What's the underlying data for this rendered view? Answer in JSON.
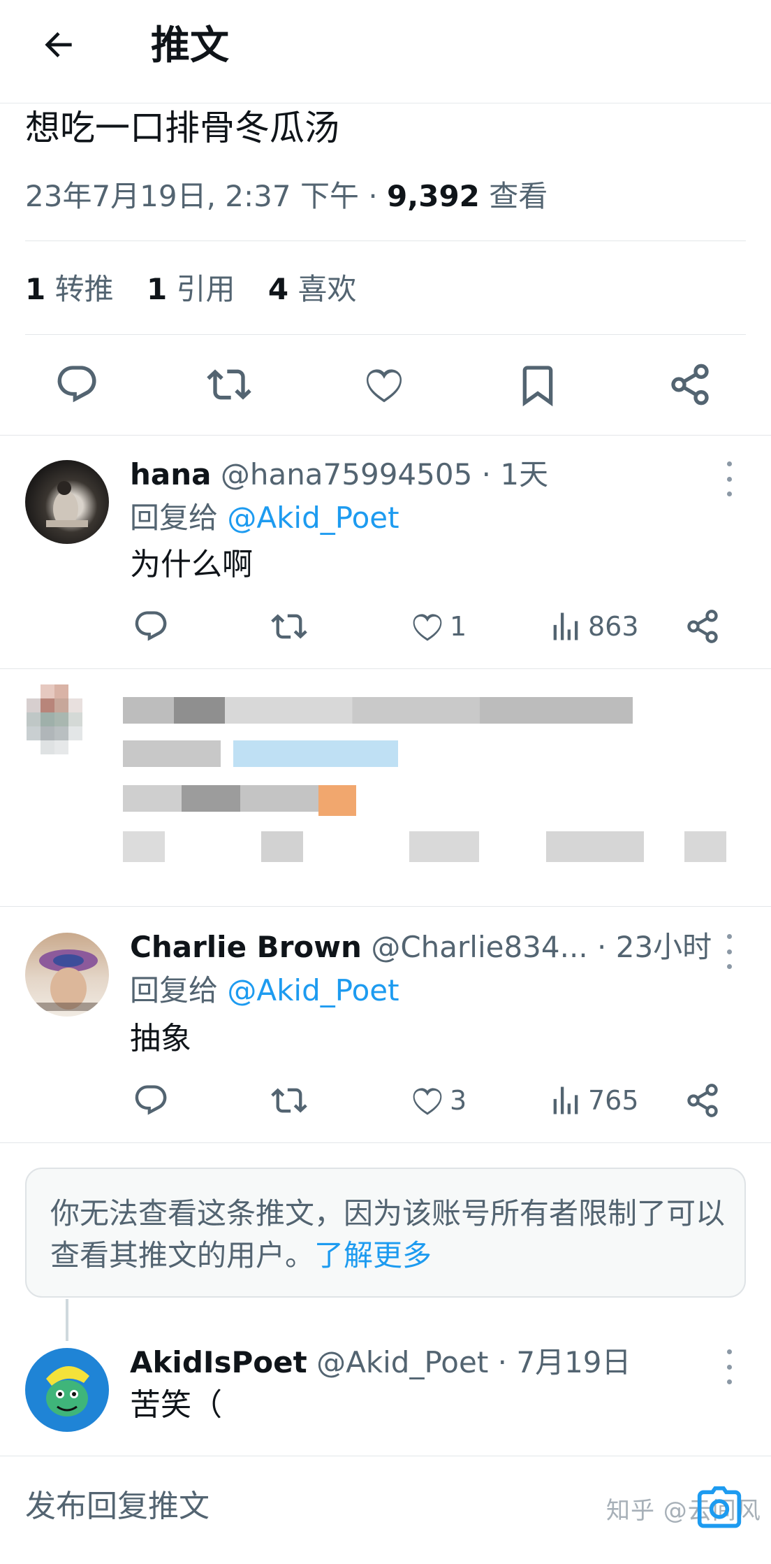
{
  "header": {
    "title": "推文"
  },
  "tweet": {
    "text": "想吃一口排骨冬瓜汤",
    "timestamp": "23年7月19日, 2:37 下午",
    "separator": " · ",
    "views_count": "9,392",
    "views_label": " 查看",
    "stats": {
      "retweets_num": "1",
      "retweets_label": " 转推",
      "quotes_num": "1",
      "quotes_label": " 引用",
      "likes_num": "4",
      "likes_label": " 喜欢"
    }
  },
  "replies": [
    {
      "name": "hana",
      "handle": " @hana75994505",
      "time": " · 1天",
      "reply_to_prefix": "回复给 ",
      "reply_to_user": "@Akid_Poet",
      "text": "为什么啊",
      "likes": "1",
      "views": "863"
    },
    {
      "name": "Charlie Brown",
      "handle": " @Charlie834...",
      "time": " · 23小时",
      "reply_to_prefix": "回复给 ",
      "reply_to_user": "@Akid_Poet",
      "text": "抽象",
      "likes": "3",
      "views": "765"
    },
    {
      "name": "AkidIsPoet",
      "handle": " @Akid_Poet",
      "time": " · 7月19日",
      "text": "苦笑（"
    }
  ],
  "restricted": {
    "message": "你无法查看这条推文，因为该账号所有者限制了可以查看其推文的用户。",
    "link": "了解更多"
  },
  "reply_bar": {
    "placeholder": "发布回复推文"
  },
  "watermark": "知乎 @云间风",
  "colors": {
    "accent": "#1d9bf0",
    "muted_text": "#536471",
    "text": "#0f1419"
  },
  "icons": [
    "back-arrow-icon",
    "reply-icon",
    "retweet-icon",
    "like-icon",
    "bookmark-icon",
    "share-icon",
    "views-icon",
    "camera-icon",
    "more-icon"
  ]
}
